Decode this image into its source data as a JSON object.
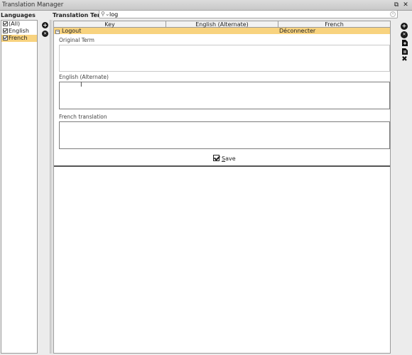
{
  "window": {
    "title": "Translation Manager",
    "restore_glyph": "⧉",
    "close_glyph": "✕"
  },
  "languages": {
    "header": "Languages",
    "items": [
      {
        "label": "(All)",
        "checked": true,
        "selected": false
      },
      {
        "label": "English",
        "checked": true,
        "selected": false
      },
      {
        "label": "French",
        "checked": true,
        "selected": true
      }
    ],
    "add_glyph": "+",
    "remove_glyph": "✕"
  },
  "terms": {
    "header": "Translation Terms",
    "search": {
      "value": "log",
      "icon": "search-icon"
    },
    "columns": [
      "Key",
      "English (Alternate)",
      "French"
    ],
    "rows": [
      {
        "key": "Logout",
        "english_alternate": "",
        "french": "Déconnecter",
        "expanded": true
      }
    ]
  },
  "detail": {
    "original_label": "Original Term",
    "english_label": "English (Alternate)",
    "french_label": "French translation",
    "original_value": "",
    "english_value": "",
    "french_value": "",
    "save_label_underlined": "S",
    "save_label_rest": "ave"
  },
  "toolbar": {
    "icons": [
      "add-icon",
      "remove-icon",
      "import-icon",
      "export-icon",
      "tools-icon"
    ],
    "add_glyph": "+",
    "remove_glyph": "✕",
    "tools_glyph": "✖"
  },
  "colors": {
    "selection": "#f8d37f",
    "background": "#ececec"
  }
}
